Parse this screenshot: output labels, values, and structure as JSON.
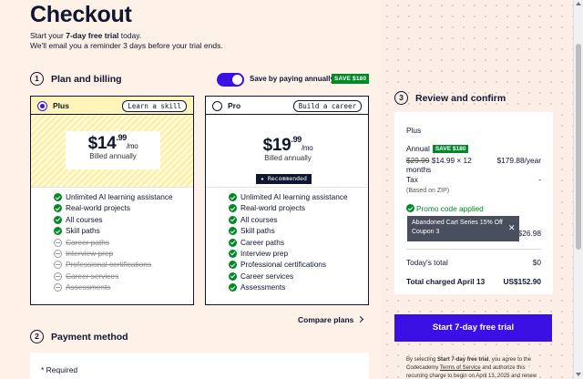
{
  "page": {
    "title": "Checkout",
    "subtitle_pre": "Start your ",
    "subtitle_bold": "7-day free trial",
    "subtitle_post": " today.",
    "subtitle_line2": "We'll email you a reminder 3 days before your trial ends."
  },
  "plan_billing": {
    "step": "1",
    "title": "Plan and billing",
    "toggle_label": "Save by paying annually",
    "toggle_on": true,
    "save_badge": "SAVE $180"
  },
  "plans": {
    "plus": {
      "name": "Plus",
      "tag": "Learn a skill",
      "price": "$14",
      "cents": ".99",
      "unit": "/mo",
      "billed": "Billed annually",
      "selected": true,
      "features": [
        {
          "label": "Unlimited AI learning assistance",
          "included": true
        },
        {
          "label": "Real-world projects",
          "included": true
        },
        {
          "label": "All courses",
          "included": true
        },
        {
          "label": "Skill paths",
          "included": true
        },
        {
          "label": "Career paths",
          "included": false
        },
        {
          "label": "Interview prep",
          "included": false
        },
        {
          "label": "Professional certifications",
          "included": false
        },
        {
          "label": "Career services",
          "included": false
        },
        {
          "label": "Assessments",
          "included": false
        }
      ]
    },
    "pro": {
      "name": "Pro",
      "tag": "Build a career",
      "price": "$19",
      "cents": ".99",
      "unit": "/mo",
      "billed": "Billed annually",
      "recommended": "★ Recommended",
      "selected": false,
      "features": [
        {
          "label": "Unlimited AI learning assistance",
          "included": true
        },
        {
          "label": "Real-world projects",
          "included": true
        },
        {
          "label": "All courses",
          "included": true
        },
        {
          "label": "Skill paths",
          "included": true
        },
        {
          "label": "Career paths",
          "included": true
        },
        {
          "label": "Interview prep",
          "included": true
        },
        {
          "label": "Professional certifications",
          "included": true
        },
        {
          "label": "Career services",
          "included": true
        },
        {
          "label": "Assessments",
          "included": true
        }
      ]
    }
  },
  "compare_plans": "Compare plans",
  "payment": {
    "step": "2",
    "title": "Payment method",
    "required": "* Required"
  },
  "review": {
    "step": "3",
    "title": "Review and confirm",
    "plan": "Plus",
    "annual_label": "Annual",
    "annual_badge": "SAVE $180",
    "old_price": "$29.99",
    "calc": "$14.99 × 12 months",
    "per_year": "$179.88/year",
    "tax_label": "Tax",
    "tax_value": "-",
    "tax_note": "(Based on ZIP)",
    "promo_applied": "Promo code applied",
    "promo_chip": "Abandoned Cart Series 15% Off Coupon 3",
    "discount_value": "$26.98",
    "todays_total_label": "Today's total",
    "todays_total_value": "$0",
    "charged_label": "Total charged April 13",
    "charged_value": "US$152.90"
  },
  "cta": {
    "start": "Start 7-day free trial"
  },
  "legal": {
    "text1": "By selecting ",
    "bold": "Start 7-day free trial",
    "text2": ", you agree to the Codecademy ",
    "tos": "Terms of Service",
    "text3": " and authorize this recurring charge to begin on April 13, 2025 and renew"
  },
  "colors": {
    "accent": "#3a10e5",
    "success": "#008a27",
    "navy": "#10162f",
    "background": "#fdf1e8",
    "plus_highlight": "#fff5b8"
  }
}
